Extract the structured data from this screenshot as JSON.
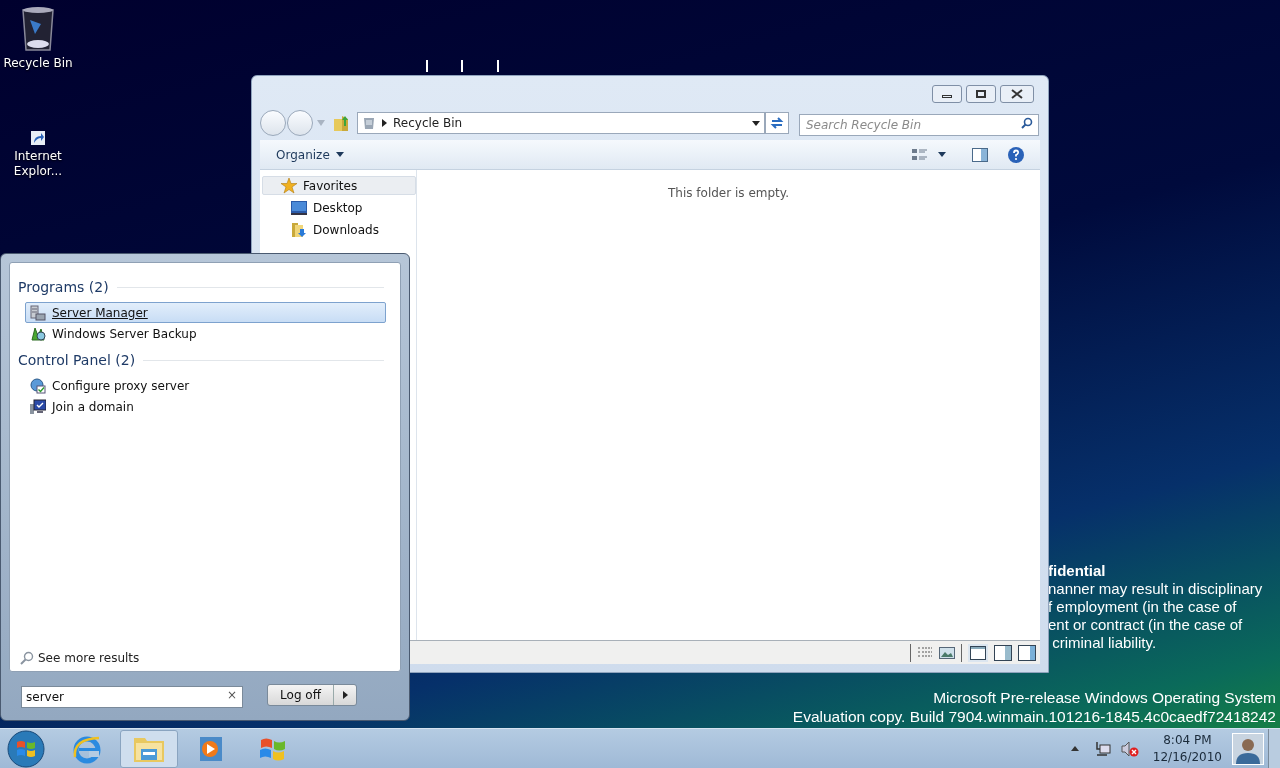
{
  "desktop": {
    "icons": [
      {
        "label": "Recycle Bin",
        "kind": "recycle"
      },
      {
        "label": "Internet Explor...",
        "kind": "shortcut"
      }
    ],
    "notice": {
      "title": "fidential",
      "lines": [
        "nanner may result in disciplinary",
        "f employment (in the case of",
        "ent or contract (in the case of",
        " criminal liability."
      ]
    },
    "build_info": [
      "Microsoft Pre-release Windows Operating System",
      "Evaluation copy. Build 7904.winmain.101216-1845.4c0caedf72418242"
    ]
  },
  "explorer": {
    "address": "Recycle Bin",
    "search": {
      "placeholder": "Search Recycle Bin"
    },
    "organize": "Organize",
    "nav": [
      {
        "label": "Favorites",
        "kind": "star",
        "selected": true,
        "children": [
          {
            "label": "Desktop",
            "kind": "desktop",
            "selected": false
          },
          {
            "label": "Downloads",
            "kind": "downloads",
            "selected": false
          }
        ]
      }
    ],
    "empty_message": "This folder is empty."
  },
  "start_menu": {
    "groups": [
      {
        "heading": "Programs (2)",
        "items": [
          {
            "label": "Server Manager",
            "kind": "server",
            "selected": true
          },
          {
            "label": "Windows Server Backup",
            "kind": "backup",
            "selected": false
          }
        ]
      },
      {
        "heading": "Control Panel (2)",
        "items": [
          {
            "label": "Configure proxy server",
            "kind": "proxy",
            "selected": false
          },
          {
            "label": "Join a domain",
            "kind": "domain",
            "selected": false
          }
        ]
      }
    ],
    "see_more": "See more results",
    "search": {
      "value": "server",
      "clear": "×"
    },
    "log_off": "Log off"
  },
  "taskbar": {
    "items": [
      {
        "kind": "ie",
        "active": false
      },
      {
        "kind": "explorer",
        "active": true
      },
      {
        "kind": "media",
        "active": false
      },
      {
        "kind": "flag",
        "active": false
      }
    ],
    "time": "8:04 PM",
    "date": "12/16/2010"
  }
}
